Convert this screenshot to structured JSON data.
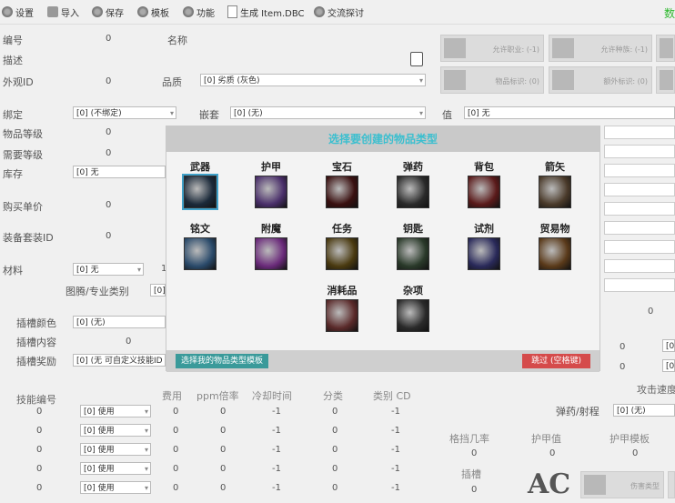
{
  "toolbar": {
    "items": [
      {
        "label": "设置",
        "icon": "gear-icon"
      },
      {
        "label": "导入",
        "icon": "import-icon"
      },
      {
        "label": "保存",
        "icon": "save-icon"
      },
      {
        "label": "模板",
        "icon": "template-icon"
      },
      {
        "label": "功能",
        "icon": "function-icon"
      },
      {
        "label": "生成 Item.DBC",
        "icon": "document-icon"
      },
      {
        "label": "交流探讨",
        "icon": "discuss-icon"
      }
    ],
    "right_text": "数"
  },
  "left": {
    "id_label": "编号",
    "id_value": "0",
    "name_label": "名称",
    "desc_label": "描述",
    "display_label": "外观ID",
    "display_value": "0",
    "quality_label": "品质",
    "quality_value": "[0] 劣质 (灰色)",
    "bind_label": "绑定",
    "bind_value": "[0] (不绑定)",
    "socket_label": "嵌套",
    "socket_value": "[0] (无)",
    "item_level_label": "物品等级",
    "item_level_value": "0",
    "req_level_label": "需要等级",
    "req_level_value": "0",
    "stock_label": "库存",
    "stock_value": "[0] 无",
    "buy_price_label": "购买单价",
    "buy_price_value": "0",
    "set_label": "装备套装ID",
    "set_value": "0",
    "material_label": "材料",
    "material_value": "[0] 无",
    "material_extra": "1",
    "totem_label": "图腾/专业类别",
    "totem_value": "[0]",
    "socket_color_label": "插槽颜色",
    "socket_color_value": "[0] (无)",
    "socket_content_label": "插槽内容",
    "socket_content_value": "0",
    "socket_bonus_label": "插槽奖励",
    "socket_bonus_value": "[0] (无 可自定义技能ID"
  },
  "right": {
    "value_label": "值",
    "value_value": "[0] 无",
    "buttons": [
      {
        "label": "允许职业: (-1)",
        "icon": "class-icon"
      },
      {
        "label": "允许种族: (-1)",
        "icon": "race-icon"
      },
      {
        "label": "物品标识: (0)",
        "icon": "flag-icon"
      },
      {
        "label": "额外标识: (0)",
        "icon": "extra-flag-icon"
      }
    ],
    "zero_a": "0",
    "zero_b": "0",
    "zero_c": "0",
    "sel_a": "[0",
    "sel_b": "[0",
    "attack_speed_label": "攻击速度",
    "ammo_label": "弹药/射程",
    "ammo_value": "[0] (无)",
    "block_label": "格挡几率",
    "block_value": "0",
    "armor_label": "护甲值",
    "armor_value": "0",
    "armor_tmpl_label": "护甲模板",
    "armor_tmpl_value": "0",
    "slot_label": "插槽",
    "slot_value": "0",
    "damage_type_label": "伤害类型",
    "ac_logo": "AC"
  },
  "spells": {
    "headers": [
      "技能编号",
      "费用",
      "ppm倍率",
      "冷却时间",
      "分类",
      "类别 CD"
    ],
    "rows": [
      {
        "id": "0",
        "trigger": "[0] 使用",
        "cost": "0",
        "ppm": "0",
        "cd": "-1",
        "cat": "0",
        "catcd": "-1"
      },
      {
        "id": "0",
        "trigger": "[0] 使用",
        "cost": "0",
        "ppm": "0",
        "cd": "-1",
        "cat": "0",
        "catcd": "-1"
      },
      {
        "id": "0",
        "trigger": "[0] 使用",
        "cost": "0",
        "ppm": "0",
        "cd": "-1",
        "cat": "0",
        "catcd": "-1"
      },
      {
        "id": "0",
        "trigger": "[0] 使用",
        "cost": "0",
        "ppm": "0",
        "cd": "-1",
        "cat": "0",
        "catcd": "-1"
      },
      {
        "id": "0",
        "trigger": "[0] 使用",
        "cost": "0",
        "ppm": "0",
        "cd": "-1",
        "cat": "0",
        "catcd": "-1"
      }
    ]
  },
  "dialog": {
    "title": "选择要创建的物品类型",
    "categories": [
      {
        "label": "武器",
        "icon": "weapon-icon",
        "color": "#1b2a3a"
      },
      {
        "label": "护甲",
        "icon": "armor-icon",
        "color": "#4a2f6a"
      },
      {
        "label": "宝石",
        "icon": "gem-icon",
        "color": "#3a1010"
      },
      {
        "label": "弹药",
        "icon": "ammo-icon",
        "color": "#2a2a2a"
      },
      {
        "label": "背包",
        "icon": "bag-icon",
        "color": "#5a1a1a"
      },
      {
        "label": "箭矢",
        "icon": "arrow-icon",
        "color": "#4a3a2a"
      },
      {
        "label": "铭文",
        "icon": "glyph-icon",
        "color": "#2a4a6a"
      },
      {
        "label": "附魔",
        "icon": "enchant-icon",
        "color": "#6a2a7a"
      },
      {
        "label": "任务",
        "icon": "quest-icon",
        "color": "#4a3a10"
      },
      {
        "label": "钥匙",
        "icon": "key-icon",
        "color": "#2a3a2a"
      },
      {
        "label": "试剂",
        "icon": "reagent-icon",
        "color": "#2a2a5a"
      },
      {
        "label": "贸易物",
        "icon": "trade-goods-icon",
        "color": "#5a3a1a"
      },
      {
        "label": "消耗品",
        "icon": "consumable-icon",
        "color": "#5a2a2a"
      },
      {
        "label": "杂项",
        "icon": "misc-icon",
        "color": "#2a2a2a"
      }
    ],
    "template_button": "选择我的物品类型模板",
    "skip_button": "跳过 (空格键)"
  }
}
